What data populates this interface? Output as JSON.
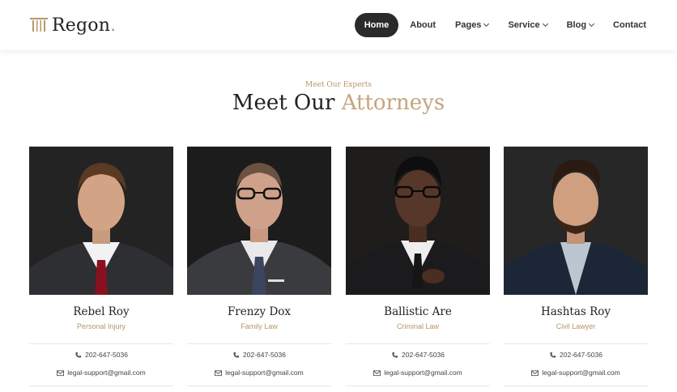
{
  "brand": {
    "name": "Regon",
    "dot": "."
  },
  "nav": [
    {
      "label": "Home",
      "active": true,
      "dropdown": false
    },
    {
      "label": "About",
      "active": false,
      "dropdown": false
    },
    {
      "label": "Pages",
      "active": false,
      "dropdown": true
    },
    {
      "label": "Service",
      "active": false,
      "dropdown": true
    },
    {
      "label": "Blog",
      "active": false,
      "dropdown": true
    },
    {
      "label": "Contact",
      "active": false,
      "dropdown": false
    }
  ],
  "section": {
    "eyebrow": "Meet Our Experts",
    "title_main": "Meet Our ",
    "title_accent": "Attorneys"
  },
  "attorneys": [
    {
      "name": "Rebel Roy",
      "role": "Personal Injury",
      "phone": "202-647-5036",
      "email": "legal-support@gmail.com"
    },
    {
      "name": "Frenzy Dox",
      "role": "Family Law",
      "phone": "202-647-5036",
      "email": "legal-support@gmail.com"
    },
    {
      "name": "Ballistic Are",
      "role": "Criminal Law",
      "phone": "202-647-5036",
      "email": "legal-support@gmail.com"
    },
    {
      "name": "Hashtas Roy",
      "role": "Civil Lawyer",
      "phone": "202-647-5036",
      "email": "legal-support@gmail.com"
    }
  ],
  "colors": {
    "accent": "#c4a47c",
    "dark": "#2a2a2a"
  }
}
